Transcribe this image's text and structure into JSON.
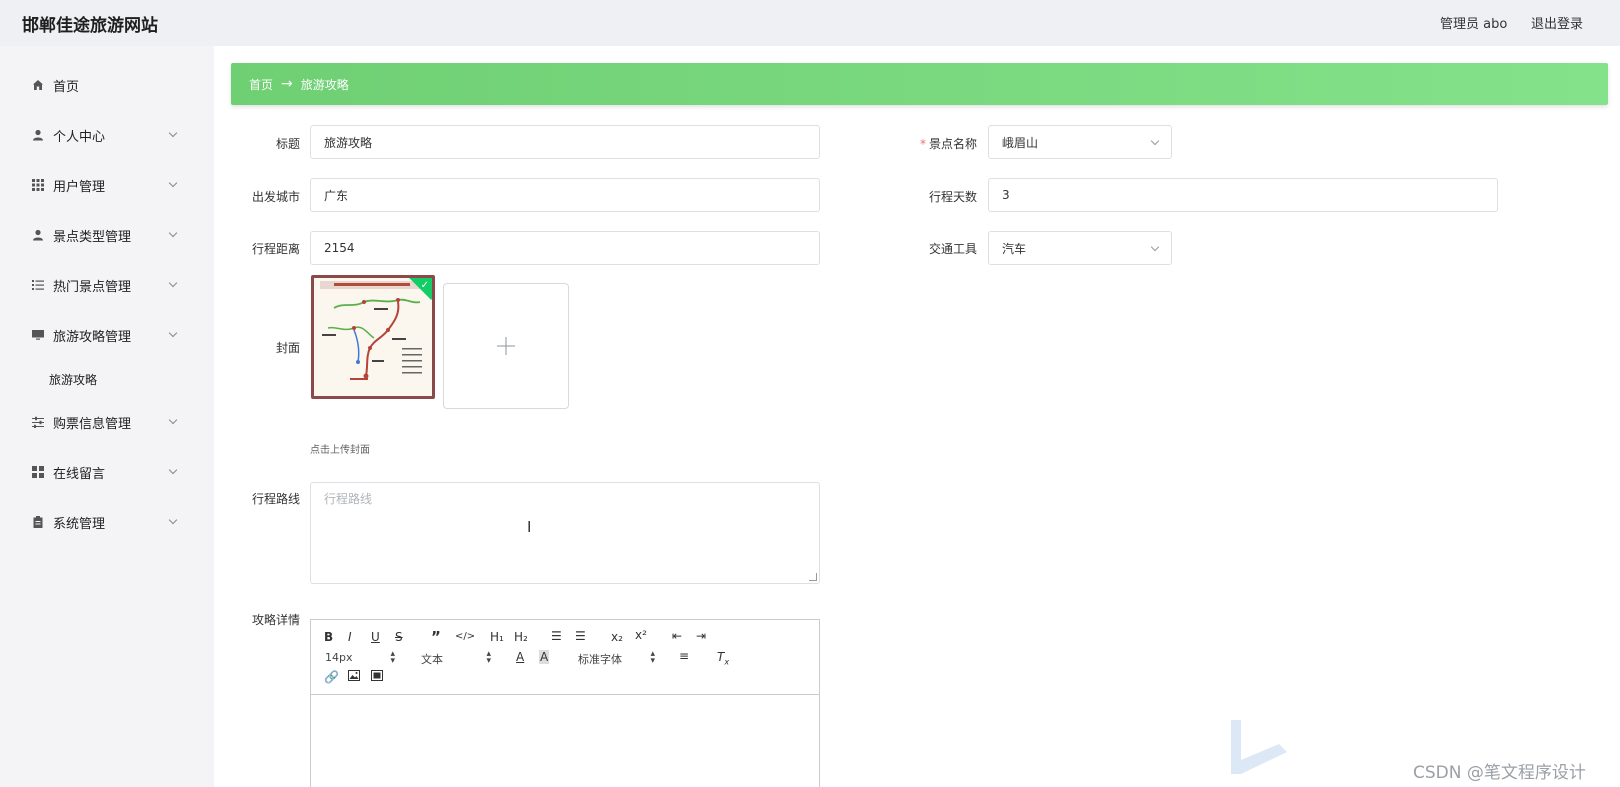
{
  "header": {
    "site_title": "邯郸佳途旅游网站",
    "user_label": "管理员 abo",
    "logout_label": "退出登录"
  },
  "sidebar": {
    "items": [
      {
        "label": "首页",
        "icon": "home-icon"
      },
      {
        "label": "个人中心",
        "icon": "user-icon"
      },
      {
        "label": "用户管理",
        "icon": "grid-icon"
      },
      {
        "label": "景点类型管理",
        "icon": "user-icon"
      },
      {
        "label": "热门景点管理",
        "icon": "list-icon"
      },
      {
        "label": "旅游攻略管理",
        "icon": "monitor-icon"
      },
      {
        "label": "购票信息管理",
        "icon": "sliders-icon"
      },
      {
        "label": "在线留言",
        "icon": "apps-icon"
      },
      {
        "label": "系统管理",
        "icon": "clipboard-icon"
      }
    ],
    "sub_items": [
      {
        "label": "旅游攻略"
      }
    ]
  },
  "breadcrumb": {
    "home": "首页",
    "separator": "→",
    "current": "旅游攻略"
  },
  "form": {
    "title": {
      "label": "标题",
      "value": "旅游攻略"
    },
    "scenic_name": {
      "label": "景点名称",
      "required_mark": "*",
      "value": "峨眉山"
    },
    "departure_city": {
      "label": "出发城市",
      "value": "广东"
    },
    "trip_days": {
      "label": "行程天数",
      "value": "3"
    },
    "trip_distance": {
      "label": "行程距离",
      "value": "2154"
    },
    "transport": {
      "label": "交通工具",
      "value": "汽车"
    },
    "cover": {
      "label": "封面",
      "tip": "点击上传封面"
    },
    "route": {
      "label": "行程路线",
      "placeholder": "行程路线"
    },
    "detail": {
      "label": "攻略详情"
    }
  },
  "editor": {
    "font_size": "14px",
    "text_style": "文本",
    "font_family": "标准字体",
    "buttons": [
      "bold",
      "italic",
      "underline",
      "strikethrough",
      "blockquote",
      "code-block",
      "header-1",
      "header-2",
      "ordered-list",
      "bullet-list",
      "subscript",
      "superscript",
      "outdent",
      "indent",
      "font-color",
      "background-color",
      "align",
      "clean",
      "link",
      "image",
      "video"
    ]
  },
  "watermark": "CSDN @笔文程序设计",
  "colors": {
    "accent_green": "#7ad87d",
    "required": "#f56c6c",
    "success": "#13ce66"
  }
}
